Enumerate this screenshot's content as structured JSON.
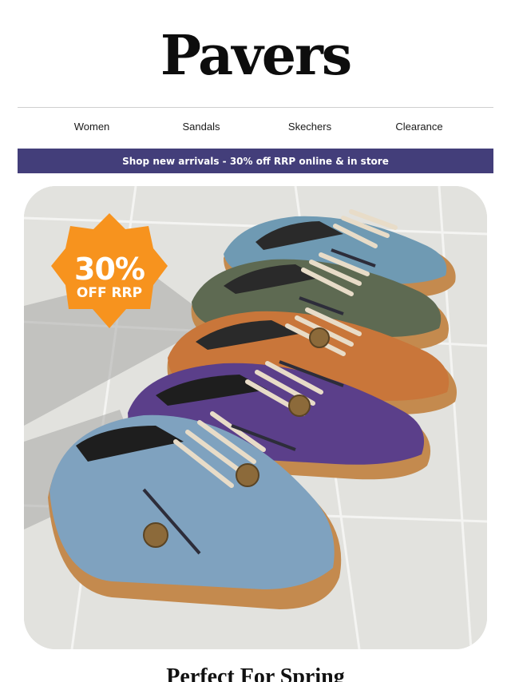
{
  "brand": {
    "logo": "Pavers"
  },
  "nav": {
    "items": [
      {
        "label": "Women"
      },
      {
        "label": "Sandals"
      },
      {
        "label": "Skechers"
      },
      {
        "label": "Clearance"
      }
    ]
  },
  "promo_bar": {
    "text": "Shop new arrivals - 30% off RRP online & in store"
  },
  "hero": {
    "badge": {
      "percent": "30%",
      "text": "OFF RRP",
      "color": "#f7931e"
    },
    "shoe_colors": [
      "#6f9ab3",
      "#5e6a52",
      "#c9763a",
      "#5b3f8a",
      "#7fa2bf"
    ],
    "sole_color": "#c48a4e",
    "lace_color": "#e8dcc8"
  },
  "section": {
    "title": "Perfect For Spring"
  },
  "colors": {
    "accent": "#433e7a",
    "badge": "#f7931e"
  }
}
